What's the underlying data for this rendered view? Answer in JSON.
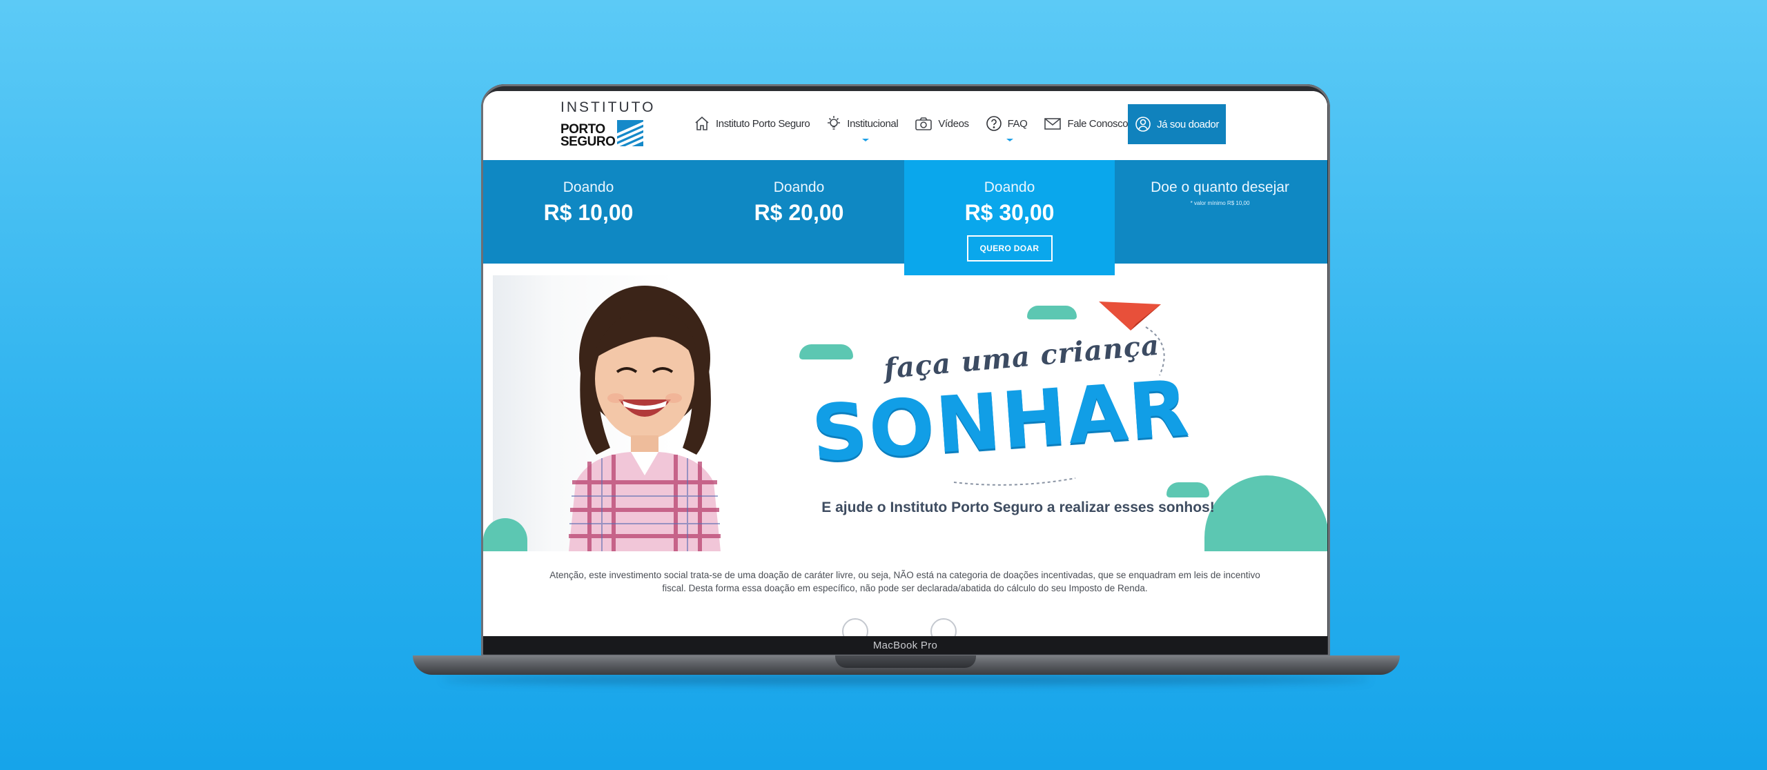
{
  "device": {
    "model_label": "MacBook Pro"
  },
  "logo": {
    "top": "INSTITUTO",
    "line1": "PORTO",
    "line2": "SEGURO"
  },
  "nav": {
    "items": [
      {
        "label": "Instituto Porto Seguro",
        "icon": "home-icon"
      },
      {
        "label": "Institucional",
        "icon": "lightbulb-icon",
        "has_dropdown": true
      },
      {
        "label": "Vídeos",
        "icon": "camera-icon"
      },
      {
        "label": "FAQ",
        "icon": "question-icon",
        "has_dropdown": true
      },
      {
        "label": "Fale Conosco",
        "icon": "mail-icon"
      }
    ],
    "donor_button": "Já sou doador"
  },
  "donation": {
    "tiers": [
      {
        "heading": "Doando",
        "amount": "R$ 10,00"
      },
      {
        "heading": "Doando",
        "amount": "R$ 20,00"
      },
      {
        "heading": "Doando",
        "amount": "R$ 30,00",
        "button": "QUERO DOAR"
      },
      {
        "heading": "Doe o quanto desejar",
        "note": "* valor mínimo R$ 10,00"
      }
    ]
  },
  "hero": {
    "slogan_top": "faça uma criança",
    "slogan_main": "SONHAR",
    "slogan_sub": "E ajude o Instituto Porto Seguro a realizar esses sonhos!"
  },
  "notice": {
    "text": "Atenção, este investimento social trata-se de uma doação de caráter livre, ou seja, NÃO está na categoria de doações incentivadas, que se enquadram em leis de incentivo fiscal. Desta forma essa doação em específico, não pode ser declarada/abatida do cálculo do seu Imposto de Renda."
  },
  "colors": {
    "background": "#2fb3ef",
    "band": "#0f88c3",
    "active_tier": "#0aa7ec",
    "brand_blue": "#119ee6",
    "cloud": "#5cc7b2",
    "plane": "#e8503a"
  }
}
